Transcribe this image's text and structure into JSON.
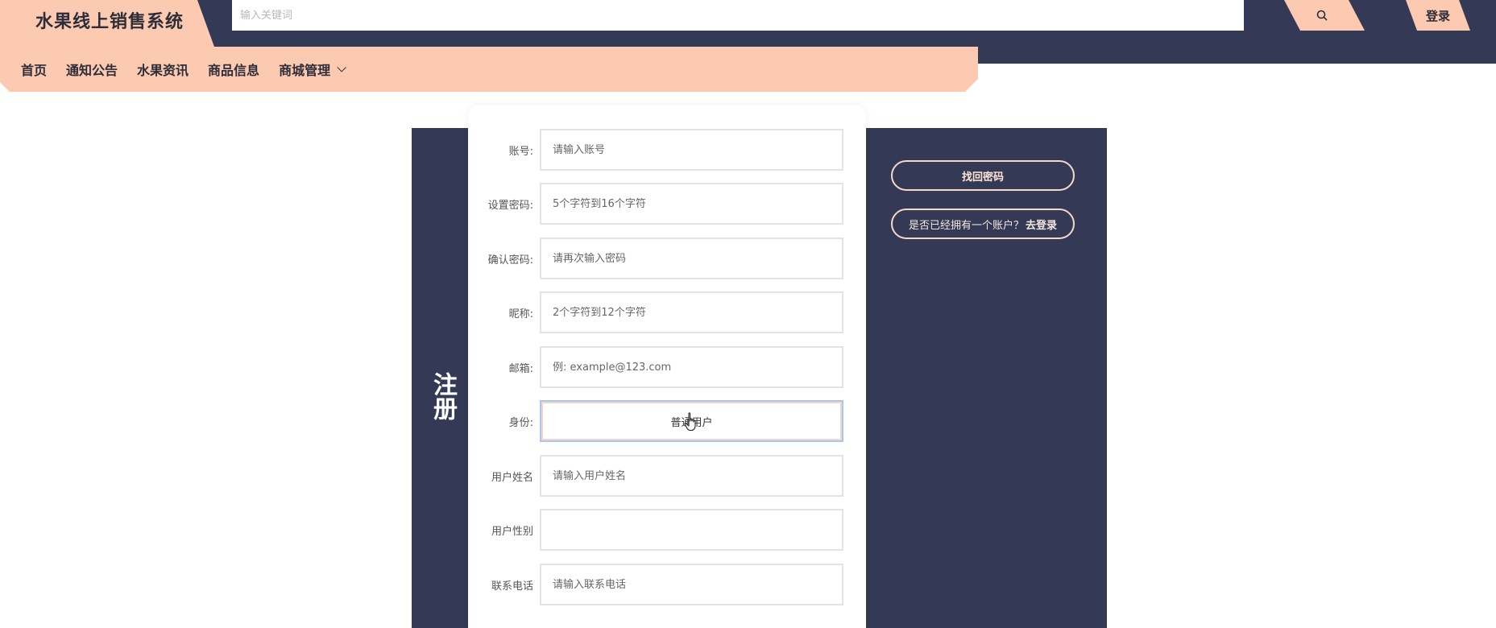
{
  "header": {
    "brand_title": "水果线上销售系统",
    "search_placeholder": "输入关键词",
    "login_label": "登录"
  },
  "nav": {
    "items": [
      {
        "label": "首页"
      },
      {
        "label": "通知公告"
      },
      {
        "label": "水果资讯"
      },
      {
        "label": "商品信息"
      },
      {
        "label": "商城管理"
      }
    ]
  },
  "register": {
    "title": "注册",
    "find_password_label": "找回密码",
    "have_account_label": "是否已经拥有一个账户？",
    "go_login_label": "去登录",
    "fields": [
      {
        "label": "账号:",
        "placeholder": "请输入账号"
      },
      {
        "label": "设置密码:",
        "placeholder": "5个字符到16个字符"
      },
      {
        "label": "确认密码:",
        "placeholder": "请再次输入密码"
      },
      {
        "label": "昵称:",
        "placeholder": "2个字符到12个字符"
      },
      {
        "label": "邮箱:",
        "placeholder": "例: example@123.com"
      },
      {
        "label": "身份:",
        "value": "普通用户"
      },
      {
        "label": "用户姓名",
        "placeholder": "请输入用户姓名"
      },
      {
        "label": "用户性别",
        "placeholder": ""
      },
      {
        "label": "联系电话",
        "placeholder": "请输入联系电话"
      }
    ]
  },
  "colors": {
    "dark_navy": "#343a56",
    "peach": "#fccab0",
    "white": "#ffffff"
  },
  "icons": {
    "search": "search-icon",
    "chevron": "chevron-down-icon",
    "cursor": "hand-pointer-icon"
  }
}
